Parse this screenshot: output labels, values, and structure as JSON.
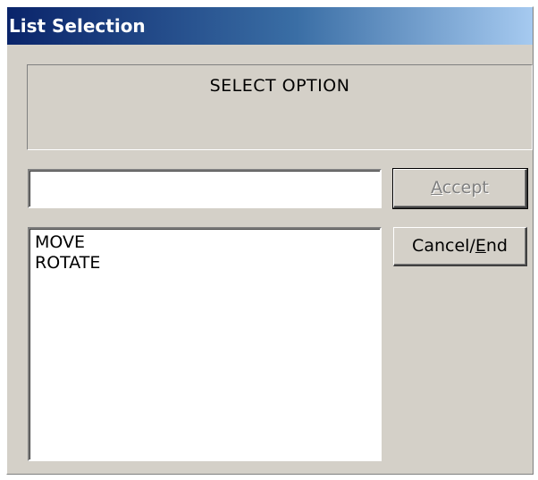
{
  "window": {
    "title": "List Selection"
  },
  "prompt": {
    "text": "SELECT OPTION"
  },
  "input": {
    "value": ""
  },
  "list": {
    "items": [
      "MOVE",
      "ROTATE"
    ]
  },
  "buttons": {
    "accept": {
      "mnemonic": "A",
      "rest": "ccept",
      "enabled": false
    },
    "cancel": {
      "prefix": "Cancel/",
      "mnemonic": "E",
      "rest": "nd"
    }
  },
  "colors": {
    "face": "#d4d0c8",
    "title_start": "#0a246a",
    "title_end": "#a6caf0"
  }
}
